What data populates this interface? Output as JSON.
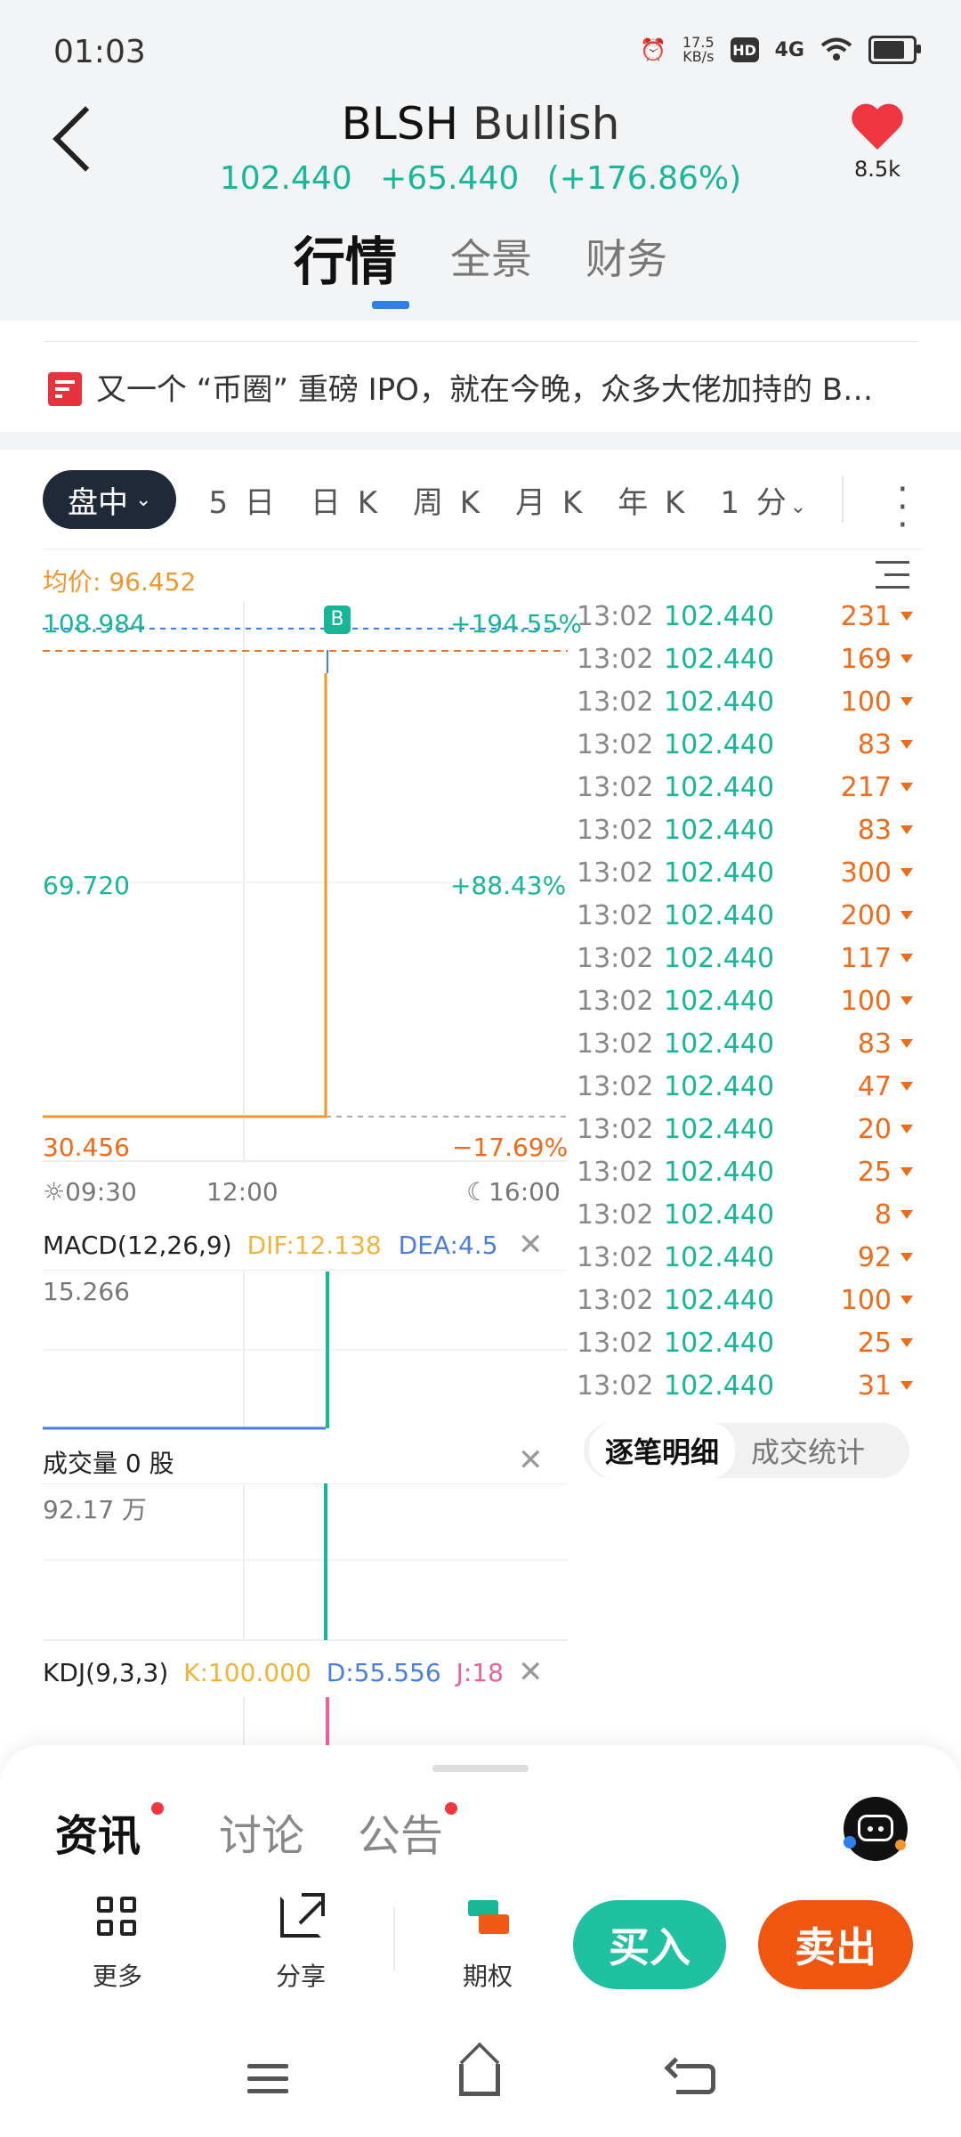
{
  "status": {
    "time": "01:03",
    "speed_value": "17.5",
    "speed_unit": "KB/s",
    "hd": "HD",
    "network": "4G"
  },
  "header": {
    "symbol": "BLSH",
    "name": "Bullish",
    "price": "102.440",
    "change": "+65.440",
    "change_pct": "(+176.86%)",
    "fav_count": "8.5k"
  },
  "main_tabs": [
    "行情",
    "全景",
    "财务"
  ],
  "news": {
    "text": "又一个 “币圈” 重磅 IPO，就在今晚，众多大佬加持的 B…"
  },
  "periods": {
    "active": "盘中",
    "items": [
      "5 日",
      "日 K",
      "周 K",
      "月 K",
      "年 K",
      "1 分"
    ]
  },
  "chart": {
    "avg_label": "均价: 96.452",
    "y_top": "108.984",
    "y_mid": "69.720",
    "y_bot": "30.456",
    "pct_top": "+194.55%",
    "pct_mid": "+88.43%",
    "pct_bot": "−17.69%",
    "marker": "B",
    "time_start": "09:30",
    "time_mid": "12:00",
    "time_end": "16:00"
  },
  "chart_data": {
    "type": "line",
    "title": "",
    "xlabel": "",
    "ylabel": "",
    "x": [
      "09:30",
      "12:00",
      "13:02",
      "16:00"
    ],
    "ylim": [
      30.456,
      108.984
    ],
    "series": [
      {
        "values": [
          37.0,
          37.0,
          102.44,
          null
        ]
      }
    ],
    "reference_lines": {
      "avg_price": 96.452,
      "prev_close": 37.0
    }
  },
  "macd": {
    "title": "MACD(12,26,9)",
    "dif": "DIF:12.138",
    "dea": "DEA:4.5",
    "value": "15.266"
  },
  "volume": {
    "title": "成交量 0 股",
    "value": "92.17 万"
  },
  "kdj": {
    "title": "KDJ(9,3,3)",
    "k": "K:100.000",
    "d": "D:55.556",
    "j": "J:18"
  },
  "trades": [
    {
      "time": "13:02",
      "price": "102.440",
      "vol": "231"
    },
    {
      "time": "13:02",
      "price": "102.440",
      "vol": "169"
    },
    {
      "time": "13:02",
      "price": "102.440",
      "vol": "100"
    },
    {
      "time": "13:02",
      "price": "102.440",
      "vol": "83"
    },
    {
      "time": "13:02",
      "price": "102.440",
      "vol": "217"
    },
    {
      "time": "13:02",
      "price": "102.440",
      "vol": "83"
    },
    {
      "time": "13:02",
      "price": "102.440",
      "vol": "300"
    },
    {
      "time": "13:02",
      "price": "102.440",
      "vol": "200"
    },
    {
      "time": "13:02",
      "price": "102.440",
      "vol": "117"
    },
    {
      "time": "13:02",
      "price": "102.440",
      "vol": "100"
    },
    {
      "time": "13:02",
      "price": "102.440",
      "vol": "83"
    },
    {
      "time": "13:02",
      "price": "102.440",
      "vol": "47"
    },
    {
      "time": "13:02",
      "price": "102.440",
      "vol": "20"
    },
    {
      "time": "13:02",
      "price": "102.440",
      "vol": "25"
    },
    {
      "time": "13:02",
      "price": "102.440",
      "vol": "8"
    },
    {
      "time": "13:02",
      "price": "102.440",
      "vol": "92"
    },
    {
      "time": "13:02",
      "price": "102.440",
      "vol": "100"
    },
    {
      "time": "13:02",
      "price": "102.440",
      "vol": "25"
    },
    {
      "time": "13:02",
      "price": "102.440",
      "vol": "31"
    }
  ],
  "trade_toggle": {
    "active": "逐笔明细",
    "inactive": "成交统计"
  },
  "bottom_tabs": [
    "资讯",
    "讨论",
    "公告"
  ],
  "tools": {
    "more": "更多",
    "share": "分享",
    "options": "期权"
  },
  "actions": {
    "buy": "买入",
    "sell": "卖出"
  },
  "colors": {
    "up": "#17b698",
    "down": "#f06a17",
    "accent": "#2e7fe8",
    "buy": "#1fc1a1",
    "sell": "#f0560f",
    "avg": "#f0962c"
  }
}
